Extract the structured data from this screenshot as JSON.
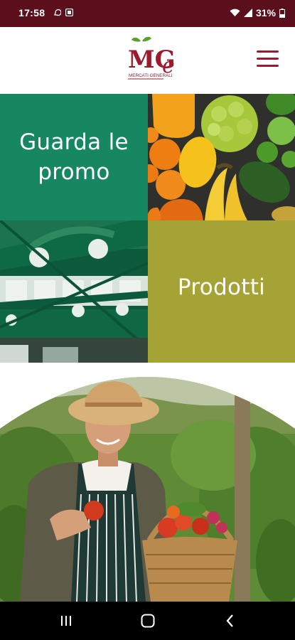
{
  "status_bar": {
    "time": "17:58",
    "battery_percent": "31%",
    "icons": [
      "whatsapp-icon",
      "notification-icon",
      "wifi-icon",
      "signal-icon",
      "battery-icon"
    ]
  },
  "header": {
    "logo": {
      "mark": "MG",
      "script": "e",
      "tagline": "MERCATI GENERALI",
      "colors": {
        "red": "#9b1a2e",
        "leaf": "#5aa02c"
      }
    },
    "menu_icon": "hamburger-menu-icon"
  },
  "tiles": {
    "promo": {
      "label": "Guarda le promo",
      "color": "#178762"
    },
    "products": {
      "label": "Prodotti",
      "color": "#a5a336"
    }
  },
  "nav_bar": {
    "buttons": [
      "recent-apps-icon",
      "home-icon",
      "back-icon"
    ]
  }
}
